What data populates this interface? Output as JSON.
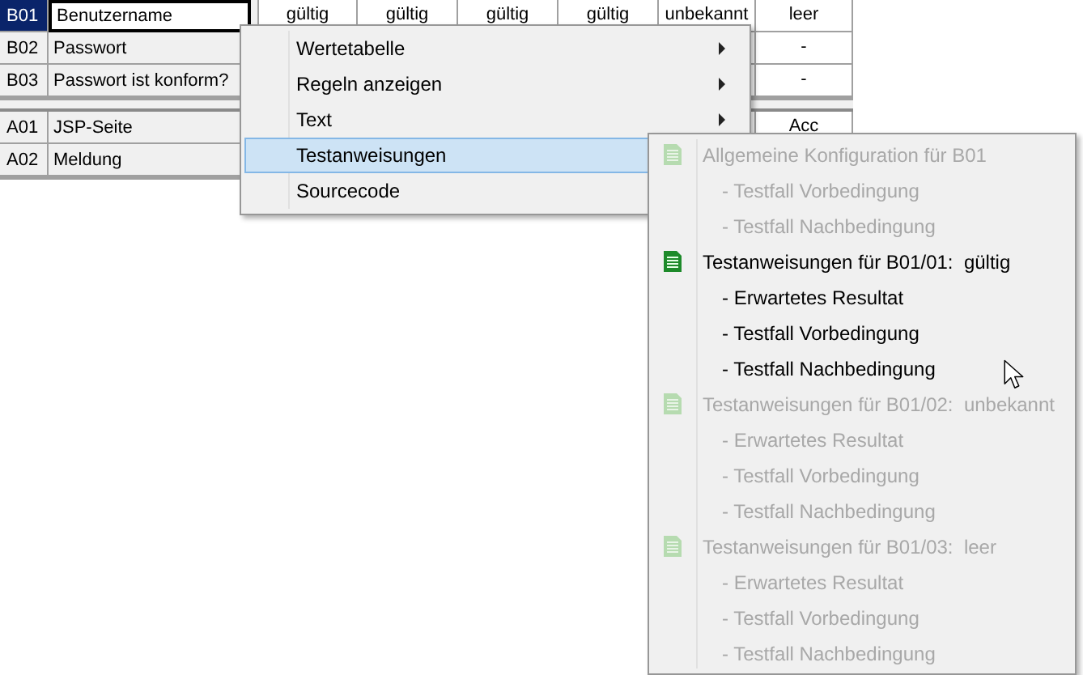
{
  "table": {
    "groups": [
      {
        "rows": [
          {
            "code": "B01",
            "name": "Benutzername",
            "selected": true,
            "values": [
              "gültig",
              "gültig",
              "gültig",
              "gültig",
              "unbekannt",
              "leer"
            ]
          },
          {
            "code": "B02",
            "name": "Passwort",
            "selected": false,
            "values": [
              "-"
            ]
          },
          {
            "code": "B03",
            "name": "Passwort ist konform?",
            "selected": false,
            "values": [
              "-"
            ]
          }
        ]
      },
      {
        "rows": [
          {
            "code": "A01",
            "name": "JSP-Seite",
            "selected": false,
            "values": [
              "Acc"
            ]
          },
          {
            "code": "A02",
            "name": "Meldung",
            "selected": false
          }
        ]
      }
    ]
  },
  "context_menu": {
    "items": [
      {
        "label": "Wertetabelle",
        "submenu": true,
        "selected": false
      },
      {
        "label": "Regeln anzeigen",
        "submenu": true,
        "selected": false
      },
      {
        "label": "Text",
        "submenu": true,
        "selected": false
      },
      {
        "label": "Testanweisungen",
        "submenu": true,
        "selected": true
      },
      {
        "label": "Sourcecode",
        "submenu": false,
        "selected": false
      }
    ]
  },
  "submenu": {
    "items": [
      {
        "kind": "header",
        "label": "Allgemeine Konfiguration für B01",
        "disabled": true
      },
      {
        "kind": "sub",
        "label": "- Testfall Vorbedingung",
        "disabled": true
      },
      {
        "kind": "sub",
        "label": "- Testfall Nachbedingung",
        "disabled": true
      },
      {
        "kind": "header",
        "label": "Testanweisungen für B01/01:  gültig",
        "disabled": false
      },
      {
        "kind": "sub",
        "label": "- Erwartetes Resultat",
        "disabled": false
      },
      {
        "kind": "sub",
        "label": "- Testfall Vorbedingung",
        "disabled": false
      },
      {
        "kind": "sub",
        "label": "- Testfall Nachbedingung",
        "disabled": false
      },
      {
        "kind": "header",
        "label": "Testanweisungen für B01/02:  unbekannt",
        "disabled": true
      },
      {
        "kind": "sub",
        "label": "- Erwartetes Resultat",
        "disabled": true
      },
      {
        "kind": "sub",
        "label": "- Testfall Vorbedingung",
        "disabled": true
      },
      {
        "kind": "sub",
        "label": "- Testfall Nachbedingung",
        "disabled": true
      },
      {
        "kind": "header",
        "label": "Testanweisungen für B01/03:  leer",
        "disabled": true
      },
      {
        "kind": "sub",
        "label": "- Erwartetes Resultat",
        "disabled": true
      },
      {
        "kind": "sub",
        "label": "- Testfall Vorbedingung",
        "disabled": true
      },
      {
        "kind": "sub",
        "label": "- Testfall Nachbedingung",
        "disabled": true
      }
    ]
  }
}
